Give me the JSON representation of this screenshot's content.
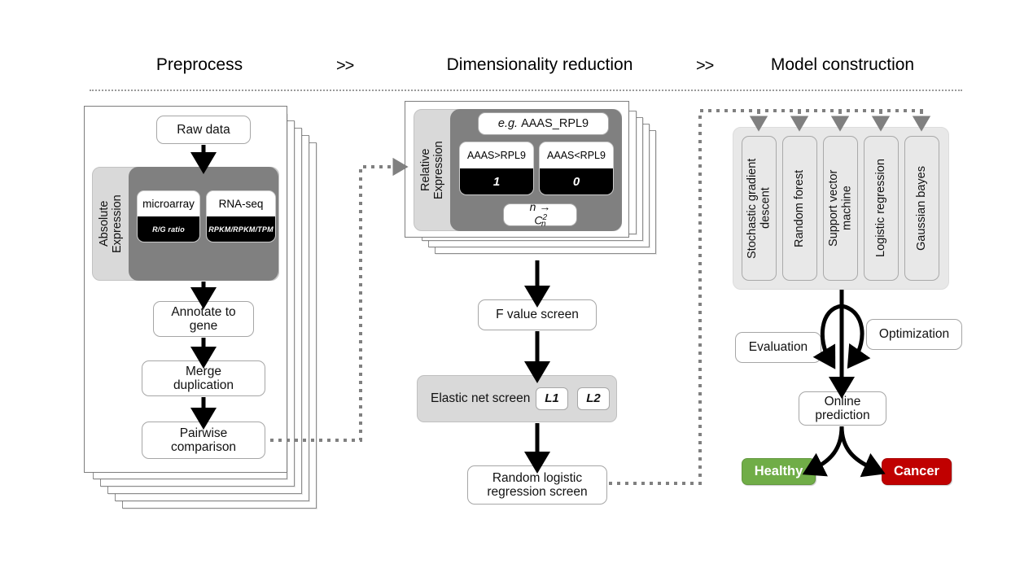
{
  "header": {
    "phases": [
      {
        "label": "Preprocess"
      },
      {
        "label": "Dimensionality reduction"
      },
      {
        "label": "Model construction"
      }
    ],
    "separators": [
      ">>",
      ">>"
    ]
  },
  "preprocess": {
    "raw_data": "Raw data",
    "absolute_expression": "Absolute\nExpression",
    "platforms": [
      {
        "name": "microarray",
        "metric": "R/G ratio"
      },
      {
        "name": "RNA-seq",
        "metric": "RPKM/RPKM/TPM"
      }
    ],
    "annotate": "Annotate to\ngene",
    "merge": "Merge\nduplication",
    "pairwise": "Pairwise\ncomparison"
  },
  "dimensionality": {
    "relative_expression": "Relative\nExpression",
    "example_label": "e.g.",
    "example_pair": "AAAS_RPL9",
    "comparisons": [
      {
        "condition": "AAAS>RPL9",
        "value": "1"
      },
      {
        "condition": "AAAS<RPL9",
        "value": "0"
      }
    ],
    "formula_n": "n",
    "formula_arrow": "→",
    "formula_c": "C",
    "formula_sup": "2",
    "formula_sub": "n",
    "f_value_screen": "F value screen",
    "elastic_net": {
      "label": "Elastic net screen",
      "penalties": [
        "L1",
        "L2"
      ]
    },
    "random_logistic": "Random logistic\nregression screen"
  },
  "model": {
    "algorithms": [
      {
        "label": "Stochastic gradient\ndescent"
      },
      {
        "label": "Random forest"
      },
      {
        "label": "Support vector\nmachine"
      },
      {
        "label": "Logistic regression"
      },
      {
        "label": "Gaussian bayes"
      }
    ],
    "evaluation": "Evaluation",
    "optimization": "Optimization",
    "online_prediction": "Online\nprediction",
    "results": [
      {
        "label": "Healthy",
        "color": "#70AD47"
      },
      {
        "label": "Cancer",
        "color": "#C00000"
      }
    ]
  },
  "colors": {
    "dark_panel": "#808080",
    "light_panel": "#d9d9d9",
    "node_border": "#a6a6a6",
    "dotted_connector": "#808080",
    "arrow": "#000000",
    "healthy": "#70AD47",
    "cancer": "#C00000"
  }
}
